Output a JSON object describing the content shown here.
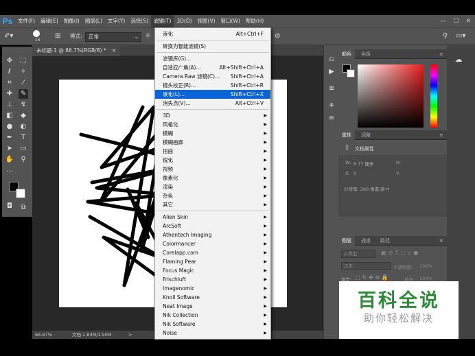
{
  "app": {
    "logo": "Ps"
  },
  "menubar": {
    "items": [
      "文件(F)",
      "编辑(E)",
      "图像(I)",
      "图层(L)",
      "文字(Y)",
      "选择(S)",
      "滤镜(T)",
      "3D(D)",
      "视图(V)",
      "窗口(W)",
      "帮助(H)"
    ],
    "active_index": 6,
    "window_controls": [
      "—",
      "☐",
      "✕"
    ]
  },
  "options": {
    "mode_label": "模式:",
    "mode_value": "正常",
    "brush_size": "15",
    "trailing_label": "不"
  },
  "document": {
    "tab_title": "未标题-1 @ 66.7%(RGB/8) *",
    "tab_close": "×"
  },
  "status": {
    "zoom": "66.67%",
    "doc_info": "文档:1.83M/1.50M",
    "arrow": ">"
  },
  "filter_menu": {
    "groups": [
      [
        {
          "label": "液化",
          "shortcut": "Alt+Ctrl+F"
        }
      ],
      [
        {
          "label": "转换为智能滤镜(S)",
          "shortcut": ""
        }
      ],
      [
        {
          "label": "滤镜库(G)...",
          "shortcut": ""
        },
        {
          "label": "自适应广角(A)...",
          "shortcut": "Alt+Shift+Ctrl+A"
        },
        {
          "label": "Camera Raw 滤镜(C)...",
          "shortcut": "Shift+Ctrl+A"
        },
        {
          "label": "镜头校正(R)...",
          "shortcut": "Shift+Ctrl+R"
        },
        {
          "label": "液化(L)...",
          "shortcut": "Shift+Ctrl+X",
          "highlighted": true
        },
        {
          "label": "消失点(V)...",
          "shortcut": "Alt+Ctrl+V"
        }
      ],
      [
        {
          "label": "3D",
          "submenu": true
        },
        {
          "label": "风格化",
          "submenu": true
        },
        {
          "label": "模糊",
          "submenu": true
        },
        {
          "label": "模糊画廊",
          "submenu": true
        },
        {
          "label": "扭曲",
          "submenu": true
        },
        {
          "label": "锐化",
          "submenu": true
        },
        {
          "label": "视频",
          "submenu": true
        },
        {
          "label": "像素化",
          "submenu": true
        },
        {
          "label": "渲染",
          "submenu": true
        },
        {
          "label": "杂色",
          "submenu": true
        },
        {
          "label": "其它",
          "submenu": true
        }
      ],
      [
        {
          "label": "Alien Skin",
          "submenu": true
        },
        {
          "label": "ArcSoft",
          "submenu": true
        },
        {
          "label": "Athentech Imaging",
          "submenu": true
        },
        {
          "label": "Colormancer",
          "submenu": true
        },
        {
          "label": "Corelapp.com",
          "submenu": true
        },
        {
          "label": "Flaming Pear",
          "submenu": true
        },
        {
          "label": "Focus Magic",
          "submenu": true
        },
        {
          "label": "Frischluft",
          "submenu": true
        },
        {
          "label": "Imagenomic",
          "submenu": true
        },
        {
          "label": "Knoll Software",
          "submenu": true
        },
        {
          "label": "Neat Image",
          "submenu": true
        },
        {
          "label": "Nik Collection",
          "submenu": true
        },
        {
          "label": "Nik Software",
          "submenu": true
        },
        {
          "label": "Noise",
          "submenu": true
        }
      ]
    ]
  },
  "panels": {
    "color_tabs": [
      "颜色",
      "色板"
    ],
    "props_tabs": [
      "属性",
      "调整"
    ],
    "props_title": "文档属性",
    "w_label": "W:",
    "w_value": "6.77 厘米",
    "h_label": "H:",
    "x_label": "X:",
    "x_value": "0",
    "y_label": "Y:",
    "resolution": "分辨率: 300 像素/英寸",
    "layers_tabs": [
      "图层",
      "通道",
      "路径"
    ],
    "kind_label": "ρ 类型",
    "blend_mode": "正常",
    "opacity_label": "不透明度:",
    "opacity_value": "100%",
    "lock_label": "锁定:",
    "fill_label": "填充:",
    "fill_value": "100%"
  },
  "watermark": {
    "line1": "百科全说",
    "line2": "助你轻松解决"
  },
  "colors": {
    "accent": "#0a64d6",
    "ps_blue": "#31a8ff",
    "panel": "#535353",
    "foreground": "#000000",
    "background": "#ffffff"
  }
}
